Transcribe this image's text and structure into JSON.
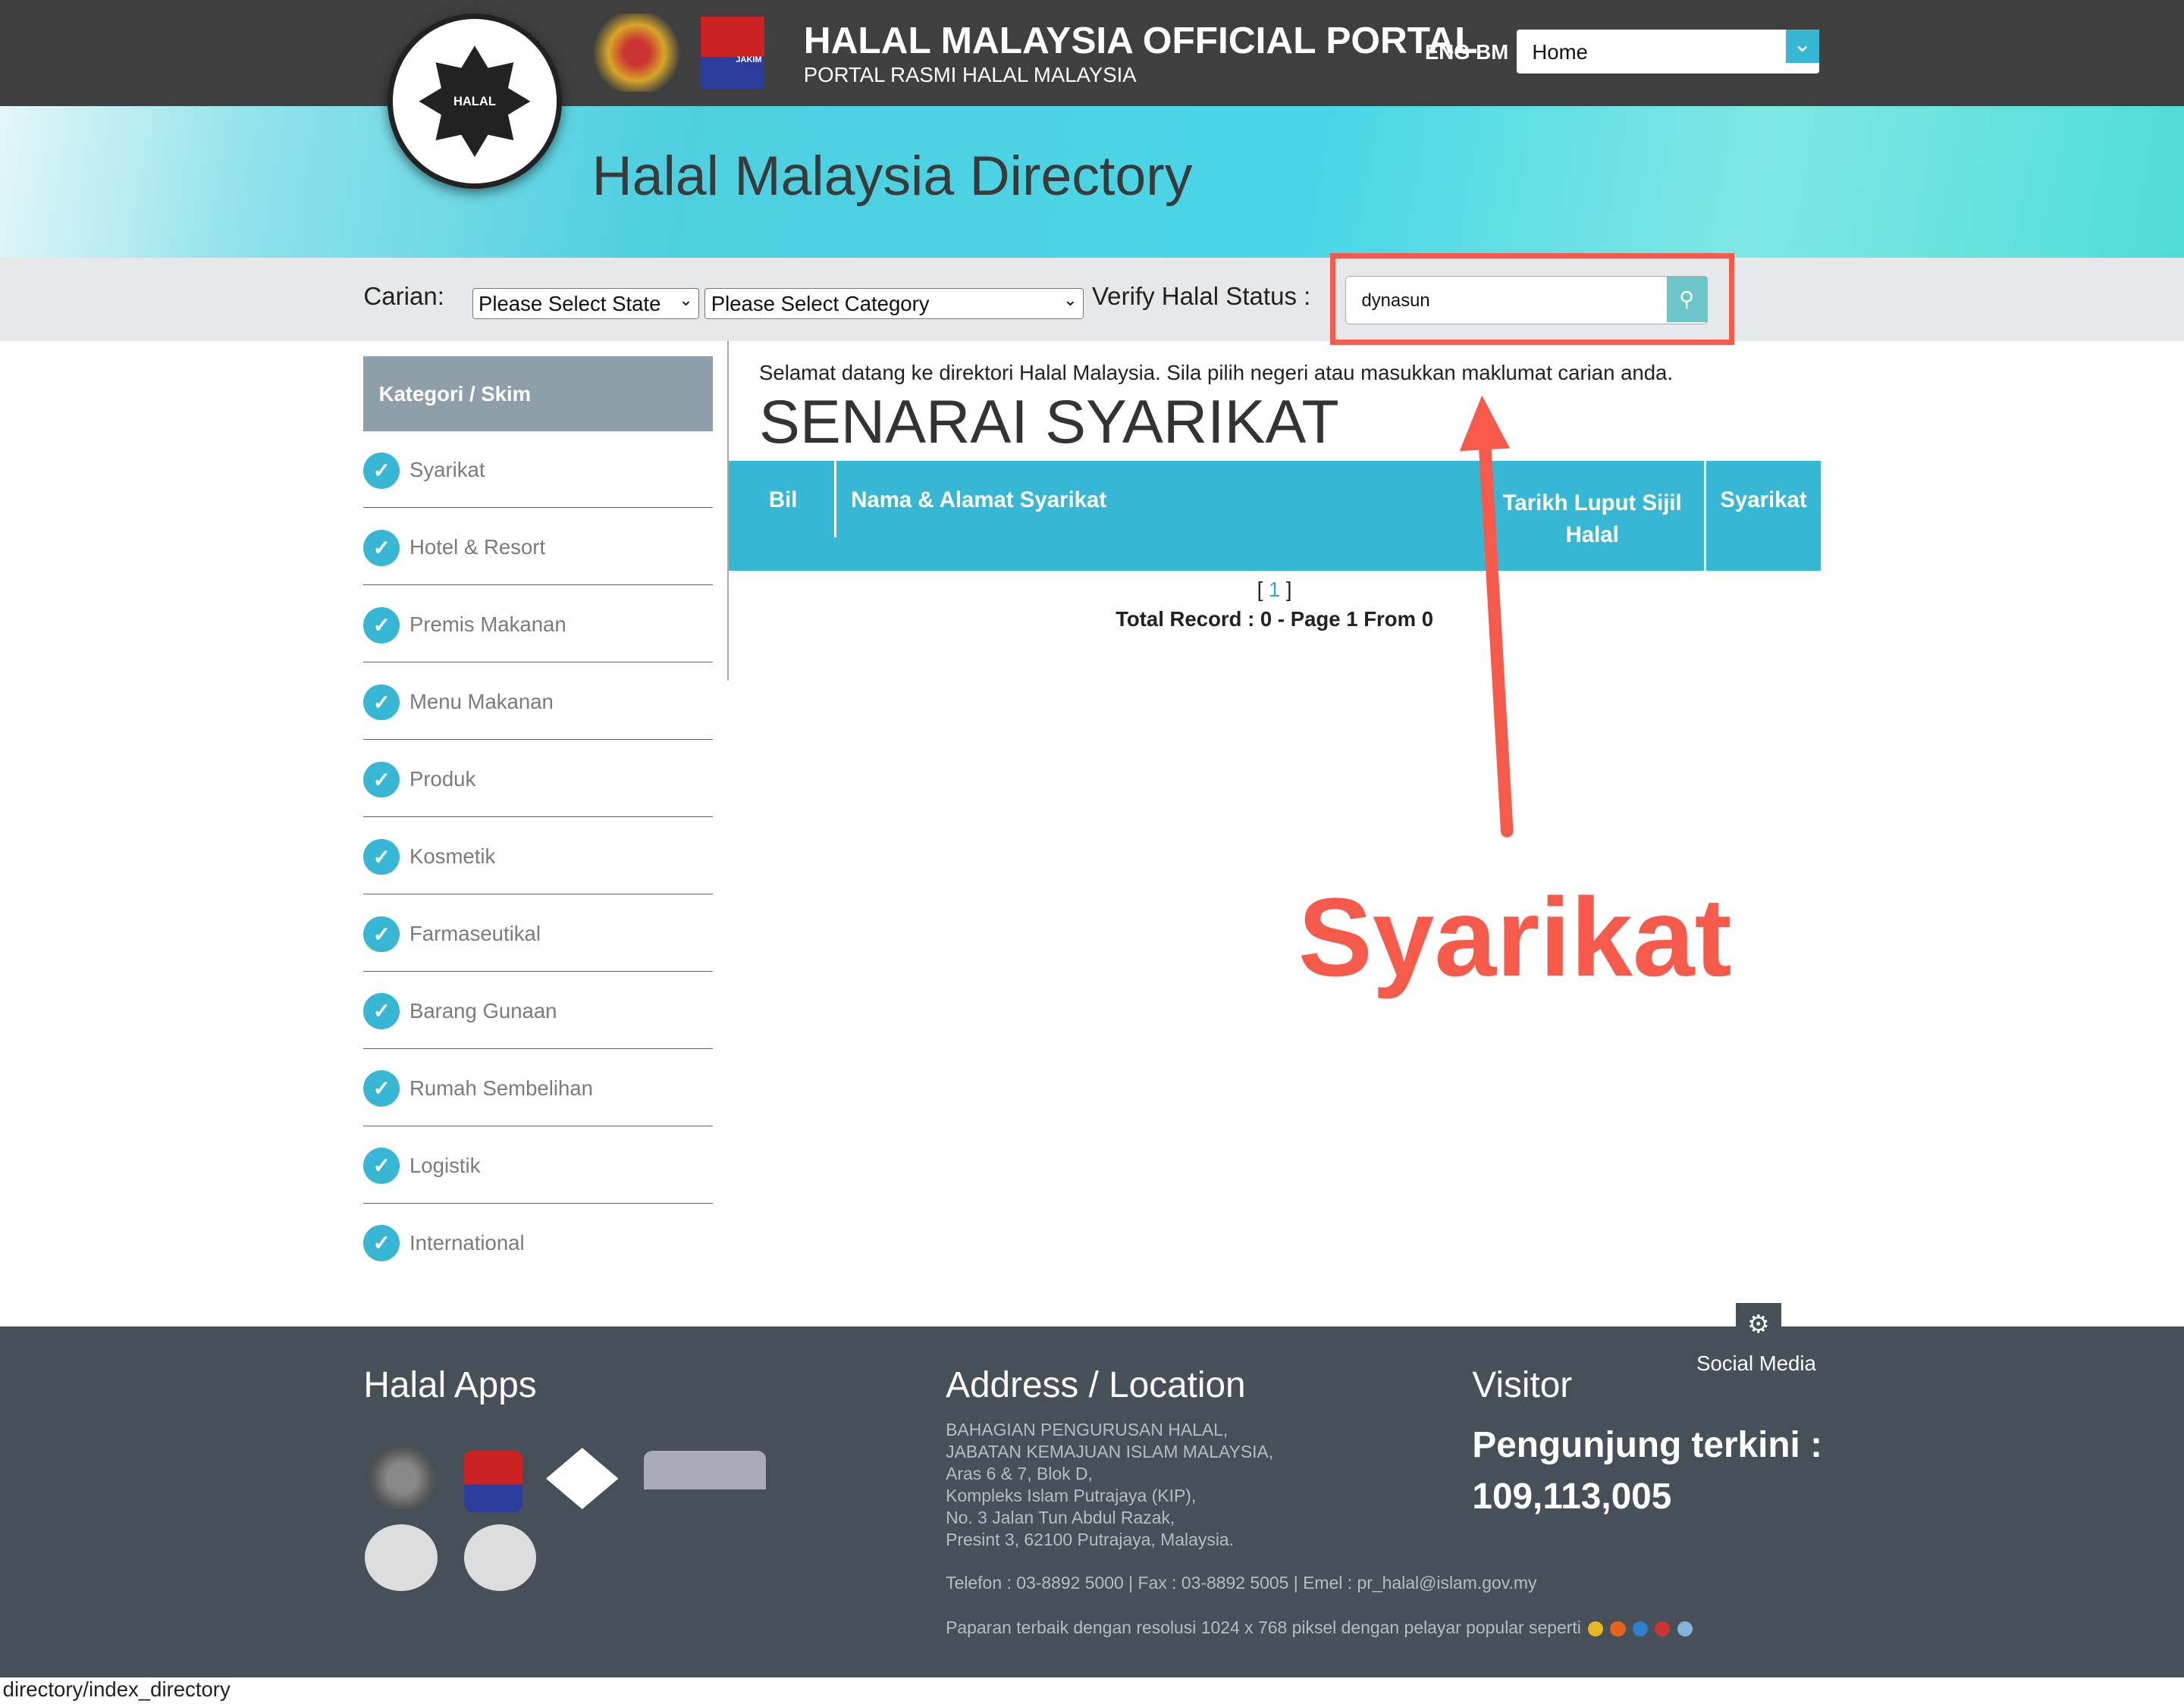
{
  "header": {
    "title": "HALAL MALAYSIA OFFICIAL PORTAL",
    "subtitle": "PORTAL RASMI HALAL MALAYSIA",
    "lang_eng": "ENG",
    "lang_bm": "BM",
    "nav_select": "Home",
    "halal_logo_text": "HALAL",
    "jakim_logo_text": "JAKIM"
  },
  "banner": {
    "title": "Halal Malaysia Directory"
  },
  "search": {
    "label": "Carian:",
    "state_select": "Please Select State",
    "category_select": "Please Select Category",
    "verify_label": "Verify Halal Status :",
    "verify_value": "dynasun"
  },
  "sidebar": {
    "heading": "Kategori / Skim",
    "items": [
      "Syarikat",
      "Hotel & Resort",
      "Premis Makanan",
      "Menu Makanan",
      "Produk",
      "Kosmetik",
      "Farmaseutikal",
      "Barang Gunaan",
      "Rumah Sembelihan",
      "Logistik",
      "International"
    ]
  },
  "main": {
    "welcome": "Selamat datang ke direktori Halal Malaysia. Sila pilih negeri atau masukkan maklumat carian anda.",
    "title": "SENARAI SYARIKAT",
    "columns": [
      "Bil",
      "Nama & Alamat Syarikat",
      "Tarikh Luput Sijil Halal",
      "Syarikat"
    ],
    "pager_open": "[ ",
    "pager_page": "1",
    "pager_close": " ]",
    "total": "Total Record : 0 - Page 1 From 0"
  },
  "footer": {
    "social": "Social Media",
    "apps_title": "Halal Apps",
    "address_title": "Address / Location",
    "address_lines": [
      "BAHAGIAN PENGURUSAN HALAL,",
      "JABATAN KEMAJUAN ISLAM MALAYSIA,",
      "Aras 6 & 7, Blok D,",
      "Kompleks Islam Putrajaya (KIP),",
      "No. 3 Jalan Tun Abdul Razak,",
      "Presint 3, 62100 Putrajaya, Malaysia."
    ],
    "contact": "Telefon : 03-8892 5000 | Fax : 03-8892 5005 | Emel : pr_halal@islam.gov.my",
    "best_view": "Paparan terbaik dengan resolusi 1024 x 768 piksel dengan pelayar popular seperti",
    "visitor_title": "Visitor",
    "visitor_label": "Pengunjung terkini :",
    "visitor_count": "109,113,005"
  },
  "status_bar": "directory/index_directory",
  "annotation": {
    "label": "Syarikat",
    "color": "#f55a4a"
  },
  "colors": {
    "accent": "#37b7d3",
    "footer": "#474f58",
    "topbar": "#3f3f3f"
  }
}
